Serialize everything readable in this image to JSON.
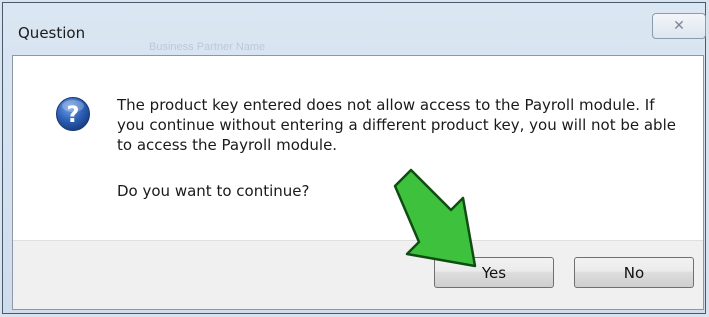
{
  "window": {
    "title": "Question",
    "close_glyph": "✕",
    "background_text": "Business Partner Name"
  },
  "dialog": {
    "icon": "question-icon",
    "message": "The product key entered does not allow access to the Payroll module. If you continue without entering a different product key, you will not be able to access the Payroll module.",
    "question": "Do you want to continue?"
  },
  "buttons": {
    "yes_label": "Yes",
    "no_label": "No"
  },
  "annotation": {
    "arrow_icon": "green-arrow-icon",
    "arrow_color": "#3ec23e"
  },
  "colors": {
    "icon_blue": "#2b5fb4",
    "footer_gray": "#f0f0f0"
  }
}
